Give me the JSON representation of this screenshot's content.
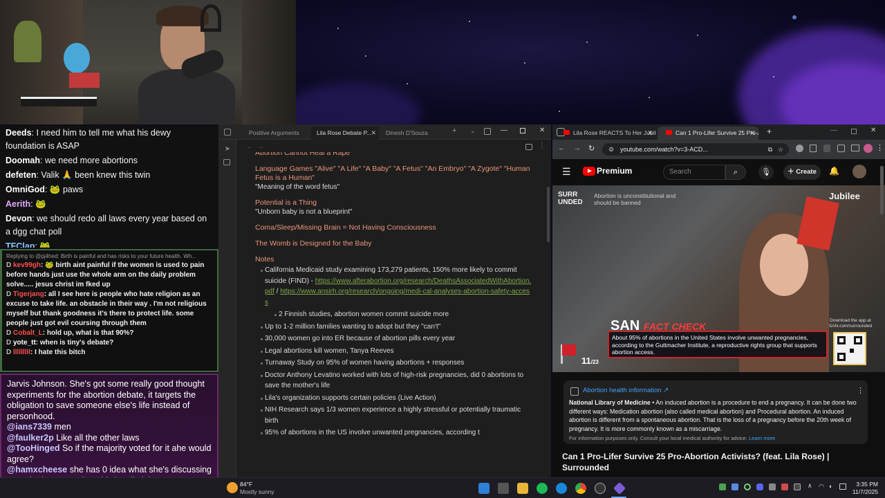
{
  "chat_top": [
    {
      "user": "Deeds",
      "color": "#ffffff",
      "text": "I need him to tell me what his dewy foundation is ASAP"
    },
    {
      "user": "Doomah",
      "color": "#ffffff",
      "text": "we need more abortions"
    },
    {
      "user": "defeten",
      "color": "#ffffff",
      "text": "Valik 🙏 been knew this twin"
    },
    {
      "user": "OmniGod",
      "color": "#ffffff",
      "text": "🐸 paws"
    },
    {
      "user": "Aerith",
      "color": "#e2a6ff",
      "text": "🐸"
    },
    {
      "user": "Devon",
      "color": "#ffffff",
      "text": "we should redo all laws every year based on a dgg chat poll"
    },
    {
      "user": "TFClap",
      "color": "#8ec3ff",
      "text": "🐸"
    }
  ],
  "chat_mid": {
    "reply_header": "Replying to @pj4hed: Birth is painful and has risks to your future health. Wh...",
    "messages": [
      {
        "user": "kev99gh",
        "color": "#ff4d4d",
        "text": "🐸 birth aint painful if the women is used to pain before hands just use the whole arm on the daily problem solve..... jesus christ im fked up"
      },
      {
        "user": "Tigerjang",
        "color": "#ff4d4d",
        "text": "all I see here is people who hate religion as an excuse to take life. an obstacle in their way . I'm not religious myself but thank goodness it's there to protect life. some people just got evil coursing through them"
      },
      {
        "user": "Cobalt_L",
        "color": "#ff4d4d",
        "text": "hold up, what is that 90%?"
      },
      {
        "user": "yote_tt",
        "color": "#ffffff",
        "text": "when is tiny's debate?"
      },
      {
        "user": "lllllllll",
        "color": "#ff4d4d",
        "text": "I hate this bitch"
      }
    ]
  },
  "chat_bottom": {
    "first_text": "Jarvis Johnson. She's got some really good thought experiments for the abortion debate, it targets the obligation to save someone else's life instead of personhood.",
    "messages": [
      {
        "user": "@ians7339",
        "text": "men"
      },
      {
        "user": "@faulker2p",
        "text": "Like all the other laws"
      },
      {
        "user": "@TooHinged",
        "text": "So if the majority voted for it ahe would agree?"
      },
      {
        "user": "@hamxcheese",
        "text": "she has 0 idea what she's discussing"
      },
      {
        "user": "@ActivelyImpressive",
        "text": "This is a lie lol"
      }
    ]
  },
  "obsidian": {
    "tabs": [
      "Positive Arguments",
      "Lila Rose Debate P...",
      "Dinesh D'Souza"
    ],
    "active_tab": 1,
    "headings": [
      {
        "text": "Abortion Cannot Heal a Rape",
        "lines": []
      },
      {
        "text": "Language Games \"Alive\" \"A Life\" \"A Baby\" \"A Fetus\" \"An Embryo\" \"A Zygote\" \"Human Fetus is a Human\"",
        "lines": [
          "\"Meaning of the word fetus\""
        ]
      },
      {
        "text": "Potential is a Thing",
        "lines": [
          "\"Unborn baby is not a blueprint\""
        ]
      },
      {
        "text": "Coma/Sleep/Missing Brain = Not Having Consciousness",
        "lines": []
      },
      {
        "text": "The Womb is Designed for the Baby",
        "lines": []
      }
    ],
    "notes_heading": "Notes",
    "notes": [
      {
        "text": "California Medicaid study examining 173,279 patients, 150% more likely to commit suicide (FIND) - ",
        "links": [
          "https://www.afterabortion.org/research/DeathsAssociatedWithAbortion.pdf",
          "https://www.ansirh.org/research/ongoing/medi-cal-analyses-abortion-safety-access"
        ],
        "sub": [
          "2 Finnish studies, abortion women commit suicide more"
        ]
      },
      {
        "text": "Up to 1-2 million families wanting to adopt but they \"can't\"",
        "links": [],
        "sub": []
      },
      {
        "text": "30,000 women go into ER because of abortion pills every year",
        "links": [],
        "sub": []
      },
      {
        "text": "Legal abortions kill women, Tanya Reeves",
        "links": [],
        "sub": []
      },
      {
        "text": "Turnaway Study on 95% of women having abortions + responses",
        "links": [],
        "sub": []
      },
      {
        "text": "Doctor Anthony Levatino worked with lots of high-risk pregnancies, did 0 abortions to save the mother's life",
        "links": [],
        "sub": []
      },
      {
        "text": "Lila's organization supports certain policies (Live Action)",
        "links": [],
        "sub": []
      },
      {
        "text": "NIH Research says 1/3 women experience a highly stressful or potentially traumatic birth",
        "links": [],
        "sub": []
      },
      {
        "text": "95% of abortions in the US involve unwanted pregnancies, according t",
        "links": [],
        "sub": []
      }
    ]
  },
  "chrome": {
    "tabs": [
      "Lila Rose REACTS To Her Jubilee",
      "Can 1 Pro-Lifer Survive 25 Pro-A"
    ],
    "active_tab": 1,
    "url": "youtube.com/watch?v=3-ACD...",
    "new_tab_symbol": "+"
  },
  "youtube": {
    "logo_text": "Premium",
    "search_placeholder": "Search",
    "create_label": "Create",
    "video": {
      "banner_top": "SURR UNDED",
      "banner_sub": "Abortion is unconstitutional and should be banned",
      "brand": "Jubilee",
      "san_logo": "SAN",
      "fact_check": "FACT CHECK",
      "fact_text": "About 95% of abortions in the United States involve unwanted pregnancies, according to the Guttmacher Institute, a reproductive rights group that supports abortion access.",
      "download_text": "Download the app at SAN.com/surrounded",
      "counter_current": "11",
      "counter_total": "/23"
    },
    "info_card": {
      "title": "Abortion health information ↗",
      "source": "National Library of Medicine",
      "body": "An induced abortion is a procedure to end a pregnancy. It can be done two different ways: Medication abortion (also called medical abortion) and Procedural abortion. An induced abortion is different from a spontaneous abortion. That is the loss of a pregnancy before the 20th week of pregnancy. It is more commonly known as a miscarriage.",
      "disclaimer": "For information purposes only. Consult your local medical authority for advice.",
      "learn_more": "Learn more"
    },
    "video_title": "Can 1 Pro-Lifer Survive 25 Pro-Abortion Activists? (feat. Lila Rose) | Surrounded"
  },
  "taskbar": {
    "weather_temp": "84°F",
    "weather_desc": "Mostly sunny",
    "time": "3:35 PM",
    "date": "11/7/2025"
  },
  "colors": {
    "heading": "#e9967a",
    "link": "#7fa64c",
    "youtube_red": "#ff0000",
    "chat_mid_border": "#3f6b3e",
    "chat_bottom_border": "#6a2a6a"
  }
}
